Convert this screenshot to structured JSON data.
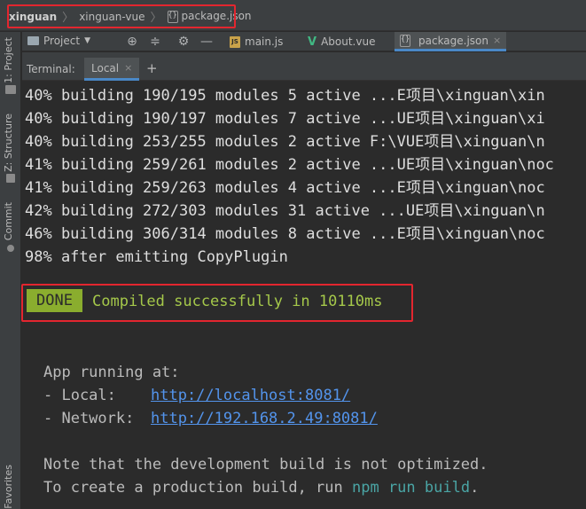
{
  "breadcrumb": {
    "root": "xinguan",
    "project": "xinguan-vue",
    "file": "package.json"
  },
  "left_strip": {
    "project_label": "1: Project",
    "structure_label": "Z: Structure",
    "commit_label": "Commit",
    "favorites_label": "Favorites"
  },
  "toolbar": {
    "project_label": "Project",
    "icons": [
      "globe-icon",
      "collapse-icon",
      "gear-icon",
      "minimize-icon"
    ]
  },
  "editor_tabs": [
    {
      "label": "main.js",
      "icon": "js-file-icon",
      "active": false
    },
    {
      "label": "About.vue",
      "icon": "vue-file-icon",
      "active": false
    },
    {
      "label": "package.json",
      "icon": "json-file-icon",
      "active": true
    }
  ],
  "terminal_tabs": {
    "label": "Terminal:",
    "local_tab": "Local",
    "close_glyph": "×",
    "add_glyph": "+"
  },
  "terminal": {
    "build_lines": [
      "40% building 190/195 modules 5 active ...E项目\\xinguan\\xin",
      "40% building 190/197 modules 7 active ...UE项目\\xinguan\\xi",
      "40% building 253/255 modules 2 active F:\\VUE项目\\xinguan\\n",
      "41% building 259/261 modules 2 active ...UE项目\\xinguan\\noc",
      "41% building 259/263 modules 4 active ...E项目\\xinguan\\noc",
      "42% building 272/303 modules 31 active ...UE项目\\xinguan\\n",
      "46% building 306/314 modules 8 active ...E项目\\xinguan\\noc",
      "98% after emitting CopyPlugin"
    ],
    "done_badge": "DONE",
    "done_message": "Compiled successfully in 10110ms",
    "app_running": "App running at:",
    "local_label": "- Local:   ",
    "local_url": "http://localhost:8081/",
    "network_label": "- Network: ",
    "network_url": "http://192.168.2.49:8081/",
    "note_line": "Note that the development build is not optimized.",
    "create_prefix": "To create a production build, run ",
    "create_cmd": "npm run build",
    "create_suffix": "."
  },
  "colors": {
    "highlight_box": "#e3262f",
    "done_badge": "#8aad2e",
    "done_text": "#a5c84a",
    "link": "#5394ec",
    "command": "#4aa5a5"
  }
}
